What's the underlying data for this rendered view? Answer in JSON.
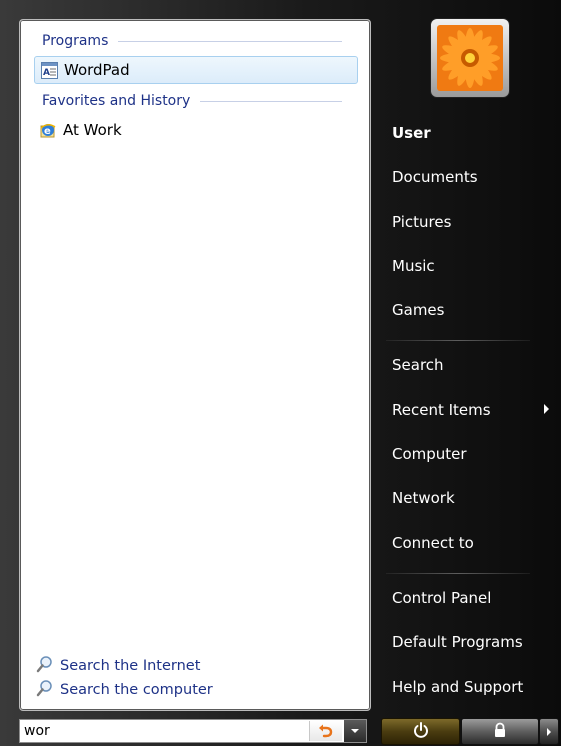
{
  "left_pane": {
    "programs_header": "Programs",
    "programs": [
      {
        "label": "WordPad",
        "icon": "wordpad-icon",
        "selected": true
      }
    ],
    "favorites_header": "Favorites and History",
    "favorites": [
      {
        "label": "At Work",
        "icon": "internet-explorer-icon"
      }
    ],
    "search_links": [
      {
        "label": "Search the Internet",
        "icon": "magnifier-icon"
      },
      {
        "label": "Search the computer",
        "icon": "magnifier-icon"
      }
    ]
  },
  "search": {
    "value": "wor",
    "clear_icon": "clear-search-icon",
    "dropdown_icon": "chevron-down-icon"
  },
  "user": {
    "avatar_icon": "flower-avatar-icon"
  },
  "right_pane": {
    "items": [
      {
        "label": "User",
        "bold": true
      },
      {
        "label": "Documents"
      },
      {
        "label": "Pictures"
      },
      {
        "label": "Music"
      },
      {
        "label": "Games"
      },
      {
        "label": "Search"
      },
      {
        "label": "Recent Items",
        "has_submenu": true
      },
      {
        "label": "Computer"
      },
      {
        "label": "Network"
      },
      {
        "label": "Connect to"
      },
      {
        "label": "Control Panel"
      },
      {
        "label": "Default Programs"
      },
      {
        "label": "Help and Support"
      }
    ]
  },
  "power": {
    "power_icon": "power-icon",
    "lock_icon": "lock-icon",
    "more_icon": "chevron-right-icon"
  },
  "colors": {
    "link_blue": "#1e3287",
    "selection_border": "#a8d0ef",
    "menu_dark": "#1a1a1a",
    "power_amber": "#7d6a2a"
  }
}
